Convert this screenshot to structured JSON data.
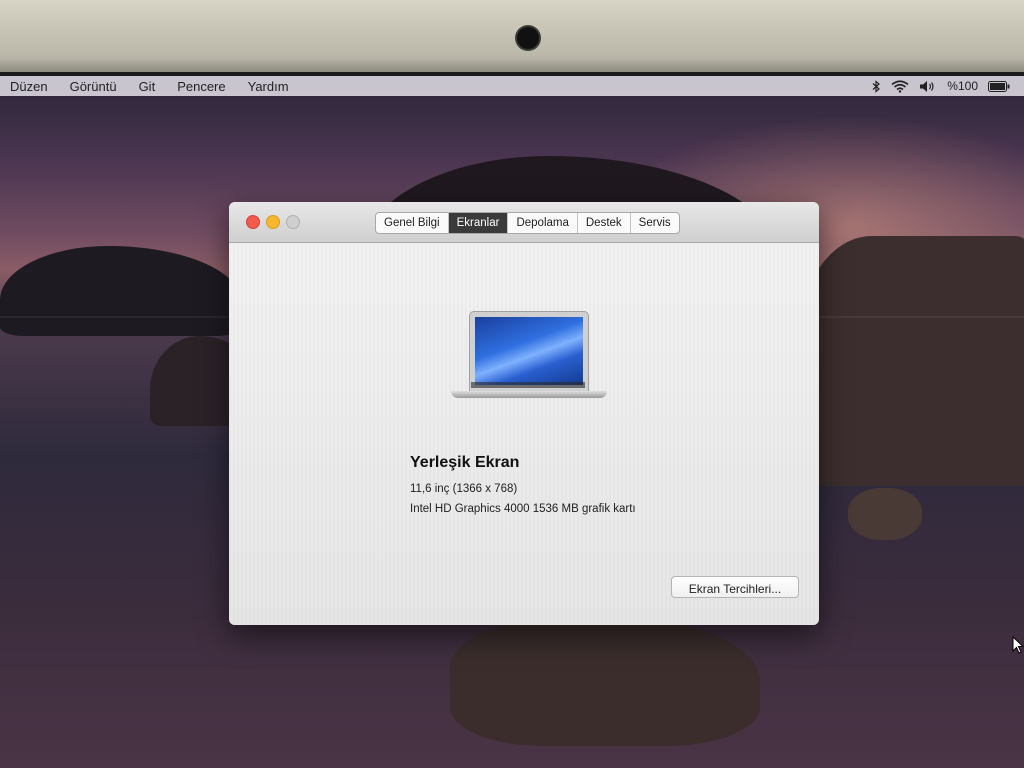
{
  "menubar": {
    "items": [
      "Düzen",
      "Görüntü",
      "Git",
      "Pencere",
      "Yardım"
    ],
    "battery_text": "%100"
  },
  "window": {
    "tabs": [
      {
        "label": "Genel Bilgi",
        "active": false
      },
      {
        "label": "Ekranlar",
        "active": true
      },
      {
        "label": "Depolama",
        "active": false
      },
      {
        "label": "Destek",
        "active": false
      },
      {
        "label": "Servis",
        "active": false
      }
    ],
    "display": {
      "title": "Yerleşik Ekran",
      "size": "11,6 inç (1366 x 768)",
      "graphics": "Intel HD Graphics 4000 1536 MB grafik kartı"
    },
    "prefs_button_label": "Ekran Tercihleri..."
  },
  "icons": {
    "bluetooth": "bluetooth-icon",
    "wifi": "wifi-icon",
    "volume": "volume-icon",
    "battery": "battery-icon"
  },
  "colors": {
    "close": "#f25a4e",
    "minimize": "#f6b62f",
    "active_tab": "#3a3a3a"
  }
}
